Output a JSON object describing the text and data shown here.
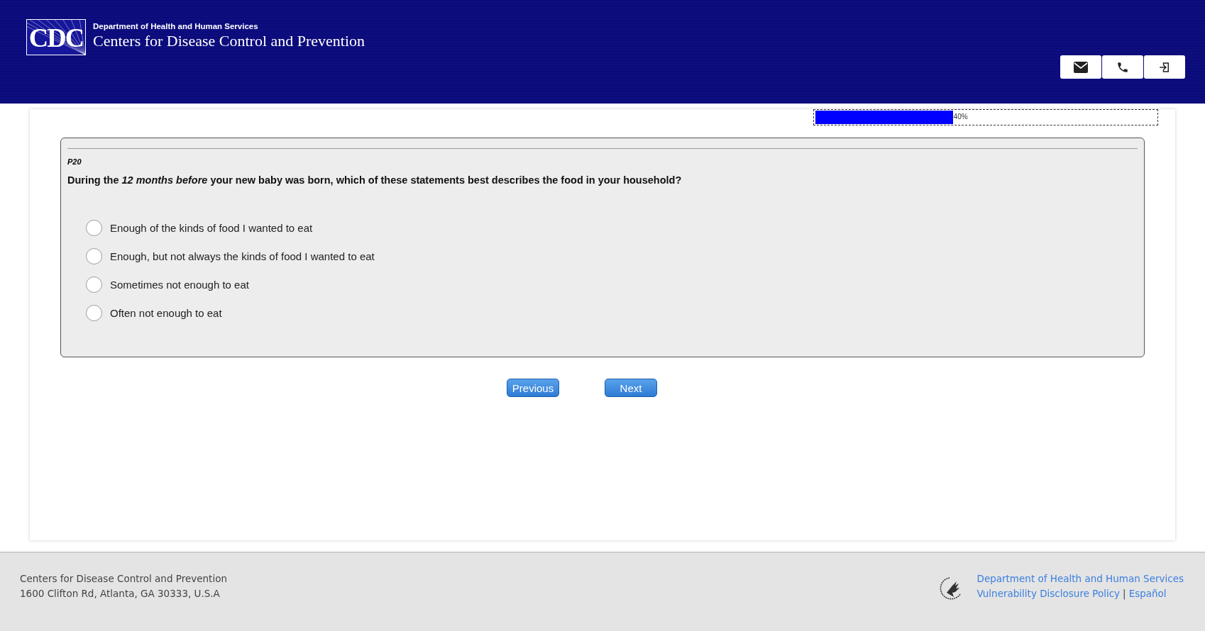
{
  "header": {
    "logo": "CDC",
    "department": "Department of Health and Human Services",
    "agency": "Centers for Disease Control and Prevention"
  },
  "progress": {
    "level": 0.4,
    "reading": "40%"
  },
  "question": {
    "code": "P20",
    "text": "During the *12 months before* your new baby was born, which of these statements best describes the food in your household?",
    "options": [
      {
        "label": "Enough of the kinds of food I wanted to eat",
        "selected": false
      },
      {
        "label": "Enough, but not always the kinds of food I wanted to eat",
        "selected": false
      },
      {
        "label": "Sometimes not enough to eat",
        "selected": false
      },
      {
        "label": "Often not enough to eat",
        "selected": false
      }
    ]
  },
  "buttons": [
    "Previous",
    "Next"
  ],
  "footer": {
    "name": "Centers for Disease Control and Prevention",
    "address": "1600 Clifton Rd, Atlanta, GA 30333, U.S.A",
    "links": [
      "Department of Health and Human Services",
      "Vulnerability Disclosure Policy",
      "Español"
    ],
    "separator": "|"
  }
}
